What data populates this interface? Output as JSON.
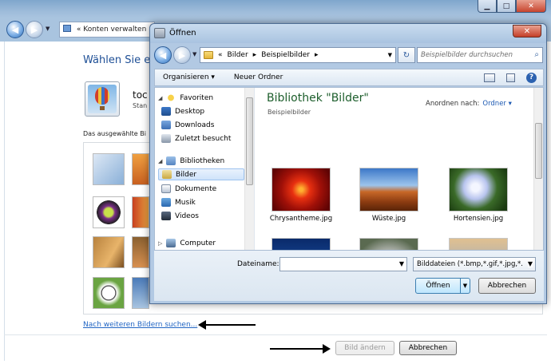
{
  "background": {
    "address": "Konten verwalten",
    "heading": "Wählen Sie ein",
    "user_name": "toc",
    "user_type": "Stan",
    "caption": "Das ausgewählte Bi",
    "browse_link": "Nach weiteren Bildern suchen...",
    "change_button": "Bild ändern",
    "cancel_button": "Abbrechen"
  },
  "dialog": {
    "title": "Öffnen",
    "breadcrumb": [
      "«",
      "Bilder",
      "▸",
      "Beispielbilder",
      "▸"
    ],
    "search_placeholder": "Beispielbilder durchsuchen",
    "toolbar": {
      "organize": "Organisieren ▾",
      "new_folder": "Neuer Ordner"
    },
    "nav": {
      "favorites": "Favoriten",
      "desktop": "Desktop",
      "downloads": "Downloads",
      "recent": "Zuletzt besucht",
      "libraries": "Bibliotheken",
      "pictures": "Bilder",
      "documents": "Dokumente",
      "music": "Musik",
      "videos": "Videos",
      "computer": "Computer"
    },
    "library_title": "Bibliothek \"Bilder\"",
    "library_sub": "Beispielbilder",
    "arrange_label": "Anordnen nach:",
    "arrange_value": "Ordner ▾",
    "files": [
      {
        "name": "Chrysantheme.jpg"
      },
      {
        "name": "Wüste.jpg"
      },
      {
        "name": "Hortensien.jpg"
      }
    ],
    "filename_label": "Dateiname:",
    "filetype": "Bilddateien (*.bmp,*.gif,*.jpg,*.",
    "open_button": "Öffnen",
    "cancel_button": "Abbrechen"
  }
}
